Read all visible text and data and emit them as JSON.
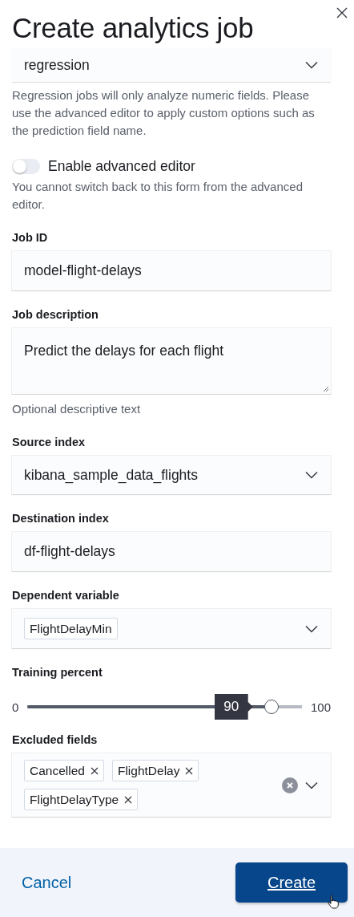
{
  "title": "Create analytics job",
  "job_type": {
    "value": "regression",
    "help": "Regression jobs will only analyze numeric fields. Please use the advanced editor to apply custom options such as the prediction field name."
  },
  "advanced_editor": {
    "label": "Enable advanced editor",
    "on": false,
    "help": "You cannot switch back to this form from the advanced editor."
  },
  "fields": [
    {
      "kind": "text",
      "label": "Job ID",
      "value": "model-flight-delays"
    },
    {
      "kind": "textarea",
      "label": "Job description",
      "value": "Predict the delays for each flight",
      "help": "Optional descriptive text"
    },
    {
      "kind": "select",
      "label": "Source index",
      "value": "kibana_sample_data_flights"
    },
    {
      "kind": "text",
      "label": "Destination index",
      "value": "df-flight-delays"
    },
    {
      "kind": "combo",
      "label": "Dependent variable",
      "chips": [
        "FlightDelayMin"
      ],
      "removable": false,
      "clearable": false
    },
    {
      "kind": "slider",
      "label": "Training percent",
      "min": "0",
      "max": "100",
      "reading": "90",
      "level": 0.9
    },
    {
      "kind": "combo",
      "label": "Excluded fields",
      "chips": [
        "Cancelled",
        "FlightDelay",
        "FlightDelayType"
      ],
      "removable": true,
      "clearable": true
    }
  ],
  "footer": {
    "cancel": "Cancel",
    "create": "Create"
  }
}
